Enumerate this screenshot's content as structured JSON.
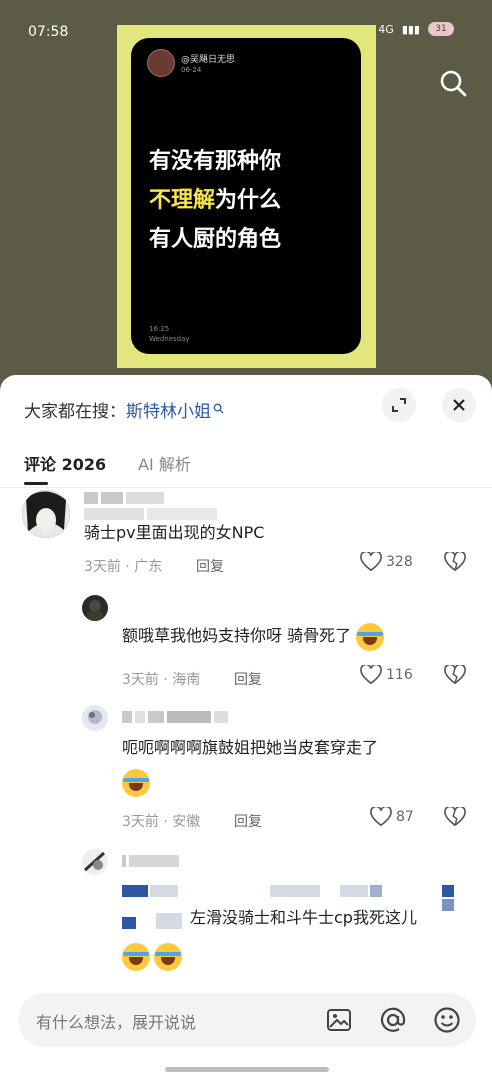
{
  "status": {
    "time": "07:58",
    "network": "4G",
    "battery": "31"
  },
  "poster": {
    "username": "@吴飓日无思",
    "date": "06-24",
    "line1": "有没有那种你",
    "line2_highlight": "不理解",
    "line2_rest": "为什么",
    "line3": "有人厨的角色",
    "clock": "16:25",
    "weekday": "Wednesday"
  },
  "sheet": {
    "suggest_prefix": "大家都在搜：",
    "suggest_keyword": "斯特林小姐",
    "tabs": [
      {
        "label": "评论 2026"
      },
      {
        "label": "AI 解析"
      }
    ]
  },
  "comments": [
    {
      "text": "骑士pv里面出现的女NPC",
      "meta": "3天前 · 广东",
      "reply": "回复",
      "likes": "328"
    },
    {
      "text": "额哦草我他妈支持你呀 骑骨死了",
      "meta": "3天前 · 海南",
      "reply": "回复",
      "likes": "116"
    },
    {
      "text": "呃呃啊啊啊旗鼓姐把她当皮套穿走了",
      "meta": "3天前 · 安徽",
      "reply": "回复",
      "likes": "87"
    },
    {
      "text": "左滑没骑士和斗牛士cp我死这儿"
    }
  ],
  "input": {
    "placeholder": "有什么想法，展开说说"
  },
  "colors": {
    "keyword": "#2b5aa8",
    "highlight": "#f6e54a",
    "frame": "#e3e67c",
    "backdrop": "#5c5c46"
  }
}
